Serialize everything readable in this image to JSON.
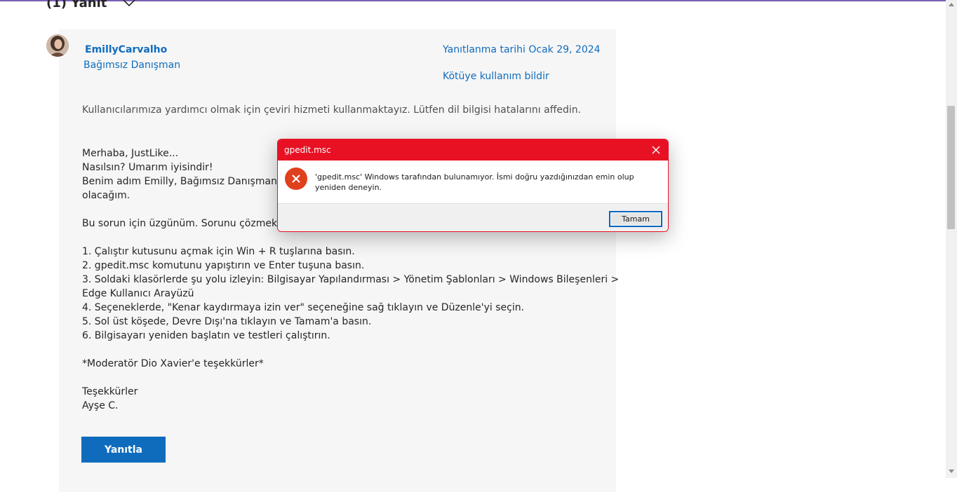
{
  "thread": {
    "replies_header": "(1) Yanıt"
  },
  "reply": {
    "author": "EmillyCarvalho",
    "role": "Bağımsız Danışman",
    "date": "Yanıtlanma tarihi Ocak 29, 2024",
    "report_link": "Kötüye kullanım bildir",
    "translation_note": "Kullanıcılarımıza yardımcı olmak için çeviri hizmeti kullanmaktayız. Lütfen dil bilgisi hatalarını affedin.",
    "body_lines": [
      "Merhaba, JustLike...",
      "Nasılsın? Umarım iyisindir!",
      "Benim adım Emilly, Bağımsız Danışman ve size yardımcı olmaktan mutluluk duyacağım. Size yardımcı",
      "olacağım.",
      "",
      "Bu sorun için üzgünüm. Sorunu çözmek için lütfen aşağıdaki adımları izleyin:",
      "",
      "1. Çalıştır kutusunu açmak için Win + R tuşlarına basın.",
      "2. gpedit.msc komutunu yapıştırın ve Enter tuşuna basın.",
      "3. Soldaki klasörlerde şu yolu izleyin: Bilgisayar Yapılandırması > Yönetim Şablonları > Windows Bileşenleri >",
      "Edge Kullanıcı Arayüzü",
      "4. Seçeneklerde, \"Kenar kaydırmaya izin ver\" seçeneğine sağ tıklayın ve Düzenle'yi seçin.",
      "5. Sol üst köşede, Devre Dışı'na tıklayın ve Tamam'a basın.",
      "6. Bilgisayarı yeniden başlatın ve testleri çalıştırın.",
      "",
      "*Moderatör Dio Xavier'e teşekkürler*",
      "",
      "Teşekkürler",
      "Ayşe C."
    ],
    "reply_button": "Yanıtla"
  },
  "dialog": {
    "title": "gpedit.msc",
    "message": "'gpedit.msc' Windows tarafından bulunamıyor. İsmi doğru yazdığınızdan emin olup yeniden deneyin.",
    "ok_button": "Tamam",
    "icon": "error-x-icon",
    "accent_color": "#e81123"
  },
  "colors": {
    "link": "#0f6cbd",
    "primary_button": "#0f6cbd",
    "card_background": "#f6f6f6"
  }
}
